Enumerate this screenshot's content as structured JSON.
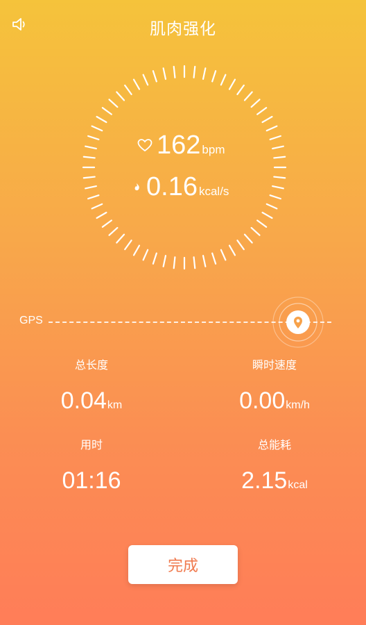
{
  "header": {
    "title": "肌肉强化",
    "sound_icon": "speaker-icon"
  },
  "dial": {
    "heart_rate": {
      "value": "162",
      "unit": "bpm",
      "icon": "heart-icon"
    },
    "calorie_rate": {
      "value": "0.16",
      "unit": "kcal/s",
      "icon": "flame-icon"
    }
  },
  "gps": {
    "label": "GPS",
    "icon": "location-pin-icon"
  },
  "stats": {
    "distance": {
      "label": "总长度",
      "value": "0.04",
      "unit": "km"
    },
    "speed": {
      "label": "瞬时速度",
      "value": "0.00",
      "unit": "km/h"
    },
    "duration": {
      "label": "用时",
      "value": "01:16"
    },
    "calories": {
      "label": "总能耗",
      "value": "2.15",
      "unit": "kcal"
    }
  },
  "actions": {
    "done_label": "完成"
  },
  "colors": {
    "accent": "#f07a4e",
    "gradient_top": "#f5c33b",
    "gradient_bottom": "#ff7d58"
  }
}
